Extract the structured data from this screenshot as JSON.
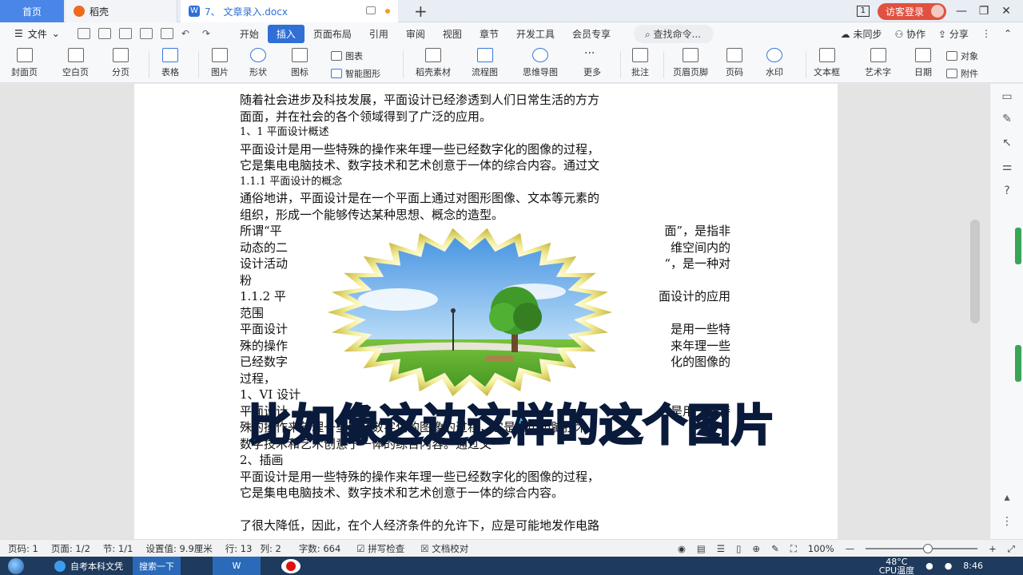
{
  "tabs": {
    "home": "首页",
    "daoke": "稻壳",
    "doc": "7、 文章录入.docx",
    "new": "+"
  },
  "titlebar_right": {
    "page_indicator": "1",
    "login": "访客登录"
  },
  "menu": {
    "file": "文件",
    "tabs": [
      "开始",
      "插入",
      "页面布局",
      "引用",
      "审阅",
      "视图",
      "章节",
      "开发工具",
      "会员专享"
    ],
    "active_tab": "插入",
    "search": "查找命令...",
    "right": [
      "未同步",
      "协作",
      "分享"
    ]
  },
  "toolbar": {
    "cover": "封面页",
    "blank": "空白页",
    "pagebreak": "分页",
    "table": "表格",
    "picture": "图片",
    "shape": "形状",
    "icon": "图标",
    "chart": "图表",
    "smartart": "智能图形",
    "daoke_material": "稻壳素材",
    "flowchart": "流程图",
    "mindmap": "思维导图",
    "more": "更多",
    "comment": "批注",
    "header_footer": "页眉页脚",
    "page_number": "页码",
    "watermark": "水印",
    "textbox": "文本框",
    "wordart": "艺术字",
    "date": "日期",
    "object": "对象",
    "attachment": "附件"
  },
  "document": {
    "lines": [
      "随着社会进步及科技发展，平面设计已经渗透到人们日常生活的方方",
      "面面，并在社会的各个领域得到了广泛的应用。",
      "1、1 平面设计概述",
      "平面设计是用一些特殊的操作来年理一些已经数字化的图像的过程，",
      "它是集电电脑技术、数字技术和艺术创意于一体的综合内容。通过文",
      "1.1.1 平面设计的概念",
      "通俗地讲，平面设计是在一个平面上通过对图形图像、文本等元素的",
      "组织，形成一个能够传达某种思想、概念的造型。"
    ],
    "wrapped": [
      {
        "left": "所谓“平",
        "right": "面”，是指非"
      },
      {
        "left": "动态的二",
        "right": "维空间内的"
      },
      {
        "left": "设计活动",
        "right": "“，是一种对"
      },
      {
        "left": "粉",
        "right": ""
      },
      {
        "left": "1.1.2  平",
        "right": "面设计的应用"
      },
      {
        "left": "范围",
        "right": ""
      },
      {
        "left": "平面设计",
        "right": "是用一些特"
      },
      {
        "left": "殊的操作",
        "right": "来年理一些"
      },
      {
        "left": "已经数字",
        "right": "化的图像的"
      },
      {
        "left": "过程，",
        "right": ""
      },
      {
        "left": "1、VI 设计",
        "right": ""
      },
      {
        "left": "平面设计",
        "right": "是用一些特"
      }
    ],
    "lines_after": [
      "殊的操作来年理一些已经数字化的图像的过程，它是集电电脑技术、",
      "数字技术和艺术创意于一体的综合内容。通过文",
      "2、插画",
      "平面设计是用一些特殊的操作来年理一些已经数字化的图像的过程，",
      "它是集电电脑技术、数字技术和艺术创意于一体的综合内容。",
      "",
      "了很大降低，因此，在个人经济条件的允许下，应是可能地发作电路"
    ]
  },
  "caption": "比如像这边这样的这个图片",
  "status": {
    "page": "页码: 1",
    "pages": "页面: 1/2",
    "section": "节: 1/1",
    "setting": "设置值: 9.9厘米",
    "row": "行: 13",
    "col": "列: 2",
    "words": "字数: 664",
    "spell": "拼写检查",
    "proof": "文档校对",
    "zoom": "100%"
  },
  "taskbar": {
    "browser": "自考本科文凭",
    "search": "搜索一下",
    "wps": "W",
    "temp": "48°C",
    "cpu": "CPU温度",
    "time": "8:46"
  }
}
